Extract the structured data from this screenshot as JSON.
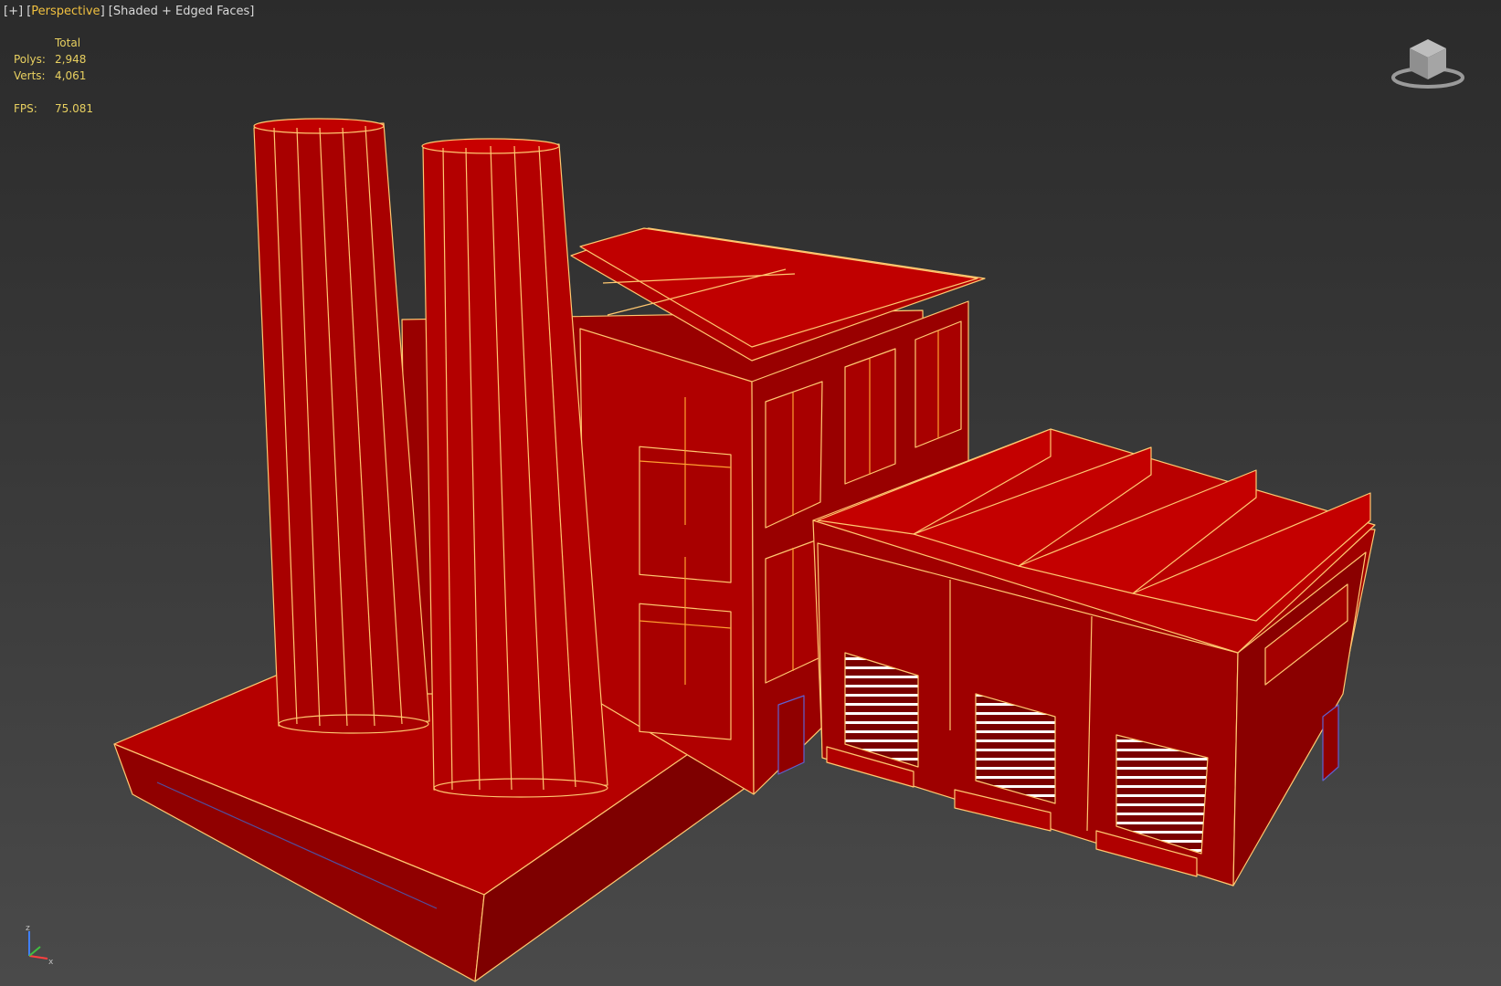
{
  "viewport": {
    "menu_label": "[+]",
    "view_label": "Perspective",
    "shading_label": "Shaded + Edged Faces"
  },
  "stats": {
    "header": "Total",
    "polys_label": "Polys:",
    "polys_value": "2,948",
    "verts_label": "Verts:",
    "verts_value": "4,061",
    "fps_label": "FPS:",
    "fps_value": "75.081"
  },
  "colors": {
    "background_top": "#2b2b2b",
    "background_bottom": "#4a4a4a",
    "model_face": "#b00000",
    "model_edge": "#ffc870",
    "stats_text": "#e8d060",
    "active_label": "#f0c040"
  },
  "icons": {
    "viewcube": "viewcube-icon",
    "axis": "axis-tripod-icon"
  },
  "axis": {
    "z_label": "z",
    "x_label": "x"
  }
}
